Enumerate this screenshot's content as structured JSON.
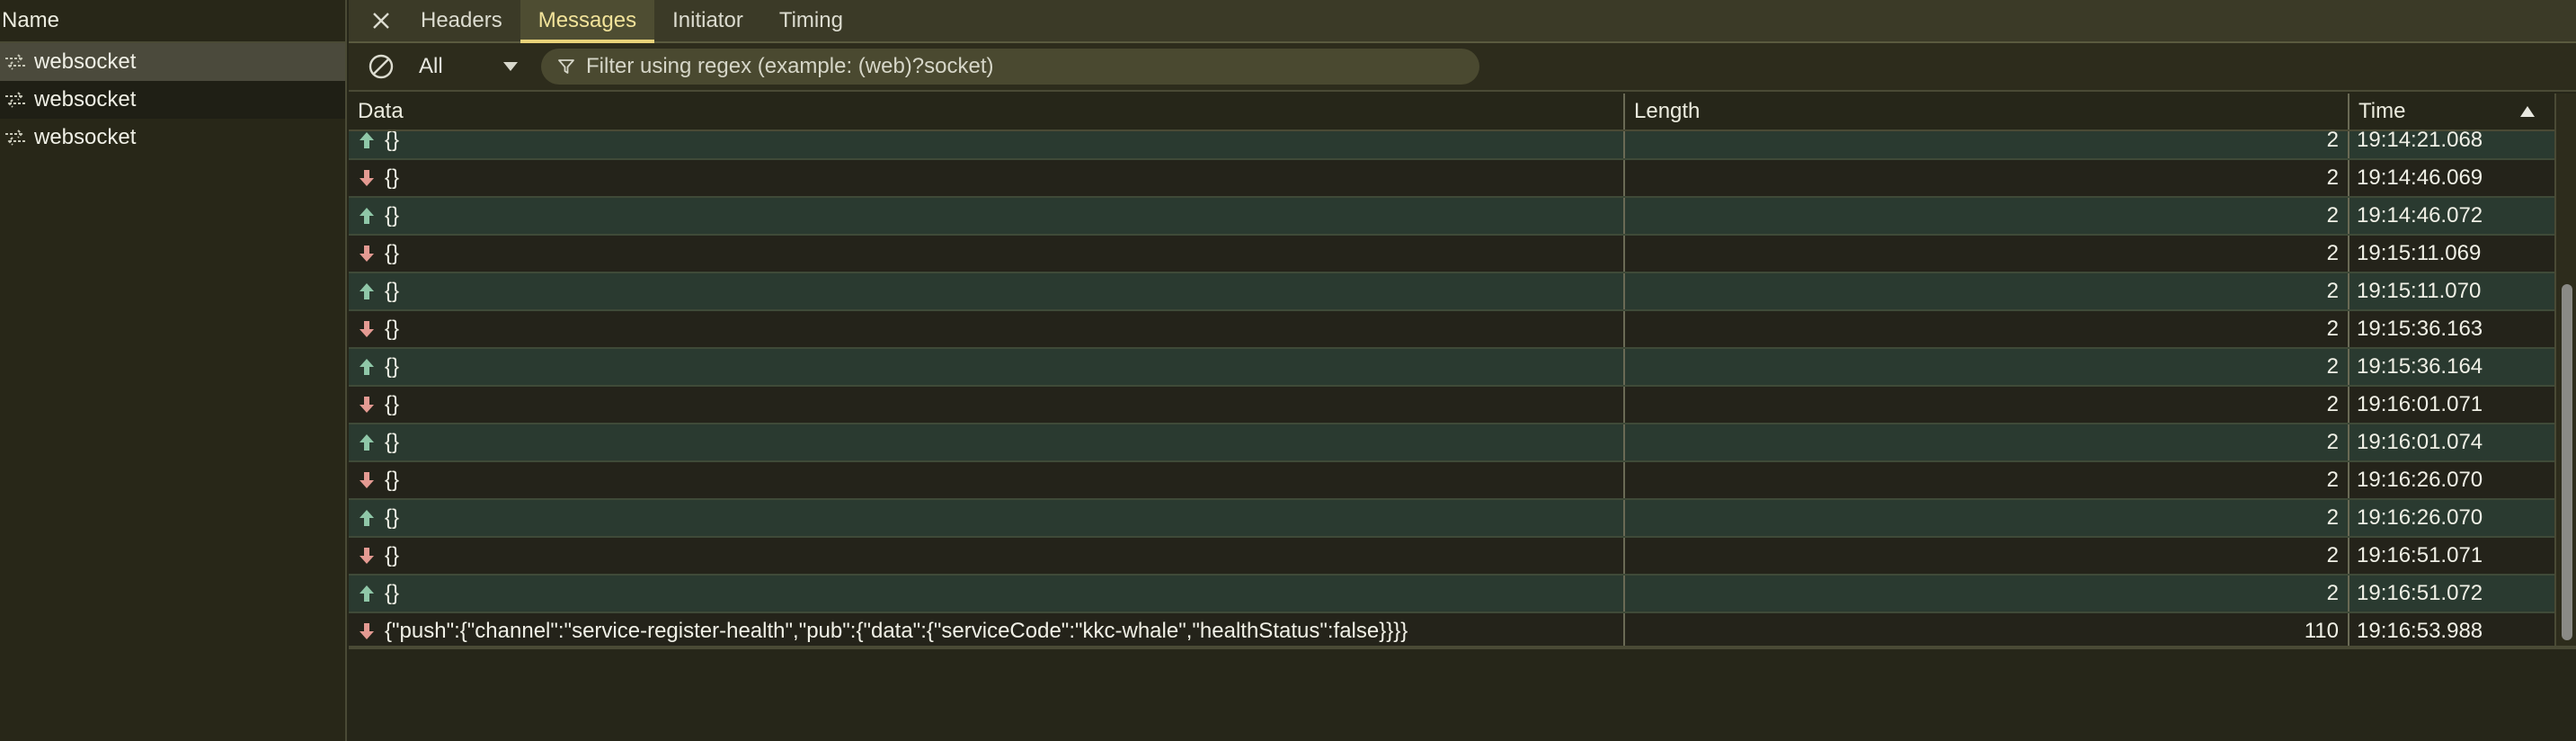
{
  "left_panel": {
    "header": "Name",
    "items": [
      {
        "label": "websocket",
        "icon": "websocket-icon"
      },
      {
        "label": "websocket",
        "icon": "websocket-icon"
      },
      {
        "label": "websocket",
        "icon": "websocket-icon"
      }
    ]
  },
  "tabs": {
    "close_icon": "close-icon",
    "items": [
      "Headers",
      "Messages",
      "Initiator",
      "Timing"
    ],
    "active": "Messages"
  },
  "toolbar": {
    "clear_icon": "block-icon",
    "filter_type": "All",
    "filter_placeholder": "Filter using regex (example: (web)?socket)"
  },
  "table": {
    "columns": [
      "Data",
      "Length",
      "Time"
    ],
    "rows": [
      {
        "dir": "up",
        "data": "{}",
        "length": "2",
        "time": "19:14:21.068"
      },
      {
        "dir": "down",
        "data": "{}",
        "length": "2",
        "time": "19:14:46.069"
      },
      {
        "dir": "up",
        "data": "{}",
        "length": "2",
        "time": "19:14:46.072"
      },
      {
        "dir": "down",
        "data": "{}",
        "length": "2",
        "time": "19:15:11.069"
      },
      {
        "dir": "up",
        "data": "{}",
        "length": "2",
        "time": "19:15:11.070"
      },
      {
        "dir": "down",
        "data": "{}",
        "length": "2",
        "time": "19:15:36.163"
      },
      {
        "dir": "up",
        "data": "{}",
        "length": "2",
        "time": "19:15:36.164"
      },
      {
        "dir": "down",
        "data": "{}",
        "length": "2",
        "time": "19:16:01.071"
      },
      {
        "dir": "up",
        "data": "{}",
        "length": "2",
        "time": "19:16:01.074"
      },
      {
        "dir": "down",
        "data": "{}",
        "length": "2",
        "time": "19:16:26.070"
      },
      {
        "dir": "up",
        "data": "{}",
        "length": "2",
        "time": "19:16:26.070"
      },
      {
        "dir": "down",
        "data": "{}",
        "length": "2",
        "time": "19:16:51.071"
      },
      {
        "dir": "up",
        "data": "{}",
        "length": "2",
        "time": "19:16:51.072"
      },
      {
        "dir": "down",
        "data": "{\"push\":{\"channel\":\"service-register-health\",\"pub\":{\"data\":{\"serviceCode\":\"kkc-whale\",\"healthStatus\":false}}}}",
        "length": "110",
        "time": "19:16:53.988"
      }
    ]
  },
  "colors": {
    "up_arrow": "#8fc7a8",
    "down_arrow": "#e49a92",
    "active_tab": "#f2e39a"
  }
}
